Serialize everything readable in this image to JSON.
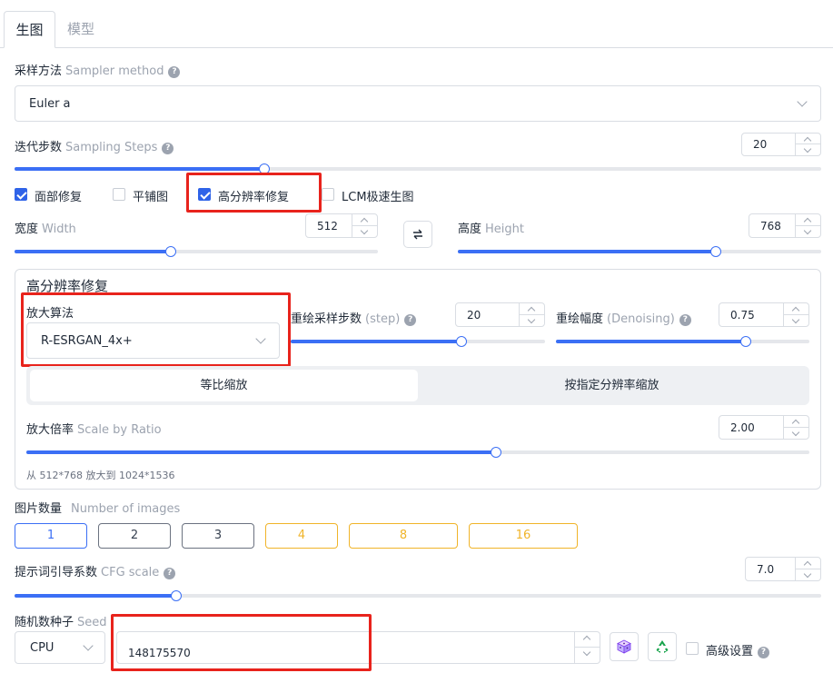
{
  "tabs": {
    "generate": "生图",
    "model": "模型"
  },
  "sampler": {
    "label": "采样方法",
    "label_en": "Sampler method",
    "value": "Euler a"
  },
  "steps": {
    "label": "迭代步数",
    "label_en": "Sampling Steps",
    "value": "20",
    "min": 1,
    "max": 150,
    "fraction": 0.31
  },
  "checkboxes": {
    "face_restore": {
      "label": "面部修复",
      "checked": true
    },
    "tiling": {
      "label": "平铺图",
      "checked": false
    },
    "hires_fix": {
      "label": "高分辨率修复",
      "checked": true
    },
    "lcm": {
      "label": "LCM极速生图",
      "checked": false
    }
  },
  "width": {
    "label": "宽度",
    "label_en": "Width",
    "value": "512",
    "fraction": 0.43
  },
  "height": {
    "label": "高度",
    "label_en": "Height",
    "value": "768",
    "fraction": 0.71
  },
  "hires": {
    "title": "高分辨率修复",
    "upscaler_label": "放大算法",
    "upscaler_value": "R-ESRGAN_4x+",
    "hires_steps": {
      "label": "重绘采样步数",
      "label_en": "(step)",
      "value": "20",
      "fraction": 0.67
    },
    "denoising": {
      "label": "重绘幅度",
      "label_en": "(Denoising)",
      "value": "0.75",
      "fraction": 0.75
    },
    "mode_ratio": "等比缩放",
    "mode_resolution": "按指定分辨率缩放",
    "scale": {
      "label": "放大倍率",
      "label_en": "Scale by Ratio",
      "value": "2.00",
      "fraction": 0.6
    },
    "summary": "从 512*768 放大到 1024*1536"
  },
  "images": {
    "label": "图片数量",
    "label_en": "Number of images",
    "options": [
      "1",
      "2",
      "3",
      "4",
      "8",
      "16"
    ],
    "selected": "1"
  },
  "cfg": {
    "label": "提示词引导系数",
    "label_en": "CFG scale",
    "value": "7.0",
    "fraction": 0.2
  },
  "seed": {
    "label": "随机数种子",
    "label_en": "Seed",
    "device": "CPU",
    "value": "148175570",
    "advanced_label": "高级设置"
  },
  "colors": {
    "accent": "#3b6ff5",
    "highlight": "#e8231c",
    "premium": "#f0b429"
  },
  "icons": {
    "help": "question-circle-icon",
    "swap": "swap-arrows-icon",
    "dice": "dice-icon",
    "recycle": "recycle-icon",
    "dropdown": "chevron-down-icon"
  }
}
